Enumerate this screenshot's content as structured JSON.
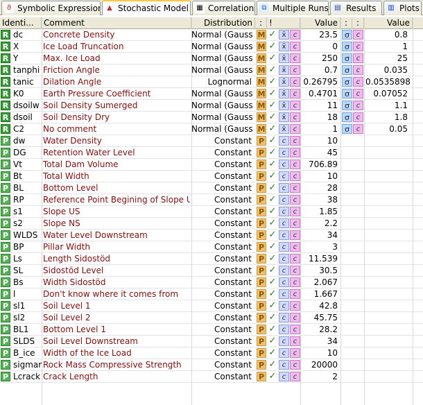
{
  "tabs": [
    {
      "label": "Symbolic Expressions",
      "icon": "symbolic-expressions-icon",
      "active": false
    },
    {
      "label": "Stochastic Model",
      "icon": "stochastic-model-icon",
      "active": true
    },
    {
      "label": "Correlations",
      "icon": "correlations-icon",
      "active": false
    },
    {
      "label": "Multiple Runs",
      "icon": "multiple-runs-icon",
      "active": false
    },
    {
      "label": "Results",
      "icon": "results-icon",
      "active": false
    },
    {
      "label": "Plots",
      "icon": "plots-icon",
      "active": false
    }
  ],
  "columns": {
    "identifier": "Identi...",
    "comment": "Comment",
    "distribution": "Distribution",
    "col_colon1": ":",
    "col_bang": "!",
    "value": "Value",
    "col_colon2": ":",
    "col_colon3": ":",
    "value2": "Value"
  },
  "glyphs": {
    "random": "R",
    "parameter": "P",
    "mean": "M",
    "param": "P",
    "check": "✓",
    "xbar": "x̄",
    "const": "c",
    "sigma": "σ"
  },
  "rows": [
    {
      "type": "R",
      "id": "dc",
      "comment": "Concrete Density",
      "distribution": "Normal (Gauss)",
      "value": "23.5",
      "value2": "0.8"
    },
    {
      "type": "R",
      "id": "X",
      "comment": "Ice Load Truncation",
      "distribution": "Normal (Gauss)",
      "value": "0",
      "value2": "1"
    },
    {
      "type": "R",
      "id": "Y",
      "comment": "Max. Ice Load",
      "distribution": "Normal (Gauss)",
      "value": "250",
      "value2": "25"
    },
    {
      "type": "R",
      "id": "tanphi",
      "comment": "Friction Angle",
      "distribution": "Normal (Gauss)",
      "value": "0.7",
      "value2": "0.035"
    },
    {
      "type": "R",
      "id": "tanic",
      "comment": "Dilation Angle",
      "distribution": "Lognormal",
      "value": "0.26795",
      "value2": "0.0535898"
    },
    {
      "type": "R",
      "id": "K0",
      "comment": "Earth Pressure Coefficient",
      "distribution": "Normal (Gauss)",
      "value": "0.4701",
      "value2": "0.07052"
    },
    {
      "type": "R",
      "id": "dsoilw",
      "comment": "Soil Density Sumerged",
      "distribution": "Normal (Gauss)",
      "value": "11",
      "value2": "1.1"
    },
    {
      "type": "R",
      "id": "dsoil",
      "comment": "Soil Density Dry",
      "distribution": "Normal (Gauss)",
      "value": "18",
      "value2": "1.8"
    },
    {
      "type": "R",
      "id": "C2",
      "comment": "No comment",
      "distribution": "Normal (Gauss)",
      "value": "1",
      "value2": "0.05"
    },
    {
      "type": "P",
      "id": "dw",
      "comment": "Water Density",
      "distribution": "Constant",
      "value": "10"
    },
    {
      "type": "P",
      "id": "DG",
      "comment": "Retention Water Level",
      "distribution": "Constant",
      "value": "45"
    },
    {
      "type": "P",
      "id": "Vt",
      "comment": "Total Dam Volume",
      "distribution": "Constant",
      "value": "706.89"
    },
    {
      "type": "P",
      "id": "Bt",
      "comment": "Total Width",
      "distribution": "Constant",
      "value": "10"
    },
    {
      "type": "P",
      "id": "BL",
      "comment": "Bottom Level",
      "distribution": "Constant",
      "value": "28"
    },
    {
      "type": "P",
      "id": "RP",
      "comment": "Reference Point Begining of Slope US",
      "distribution": "Constant",
      "value": "38"
    },
    {
      "type": "P",
      "id": "s1",
      "comment": "Slope US",
      "distribution": "Constant",
      "value": "1.85"
    },
    {
      "type": "P",
      "id": "s2",
      "comment": "Slope NS",
      "distribution": "Constant",
      "value": "2.2"
    },
    {
      "type": "P",
      "id": "WLDS",
      "comment": "Water Level Downstream",
      "distribution": "Constant",
      "value": "34"
    },
    {
      "type": "P",
      "id": "BP",
      "comment": "Pillar Width",
      "distribution": "Constant",
      "value": "3"
    },
    {
      "type": "P",
      "id": "Ls",
      "comment": "Length Sidostöd",
      "distribution": "Constant",
      "value": "11.539"
    },
    {
      "type": "P",
      "id": "SL",
      "comment": "Sidostöd Level",
      "distribution": "Constant",
      "value": "30.5"
    },
    {
      "type": "P",
      "id": "Bs",
      "comment": "Width Sidostöd",
      "distribution": "Constant",
      "value": "2.067"
    },
    {
      "type": "P",
      "id": "l",
      "comment": "Don't know where it comes from",
      "distribution": "Constant",
      "value": "1.667"
    },
    {
      "type": "P",
      "id": "sl1",
      "comment": "Soil Level 1",
      "distribution": "Constant",
      "value": "42.8"
    },
    {
      "type": "P",
      "id": "sl2",
      "comment": "Soil Level 2",
      "distribution": "Constant",
      "value": "45.75"
    },
    {
      "type": "P",
      "id": "BL1",
      "comment": "Bottom Level 1",
      "distribution": "Constant",
      "value": "28.2"
    },
    {
      "type": "P",
      "id": "SLDS",
      "comment": "Soil Level Downstream",
      "distribution": "Constant",
      "value": "34"
    },
    {
      "type": "P",
      "id": "B_ice",
      "comment": "Width of the Ice Load",
      "distribution": "Constant",
      "value": "10"
    },
    {
      "type": "P",
      "id": "sigmar",
      "comment": "Rock Mass Compressive Strength",
      "distribution": "Constant",
      "value": "20000"
    },
    {
      "type": "P",
      "id": "Lcrack",
      "comment": "Crack Length",
      "distribution": "Constant",
      "value": "2"
    }
  ]
}
